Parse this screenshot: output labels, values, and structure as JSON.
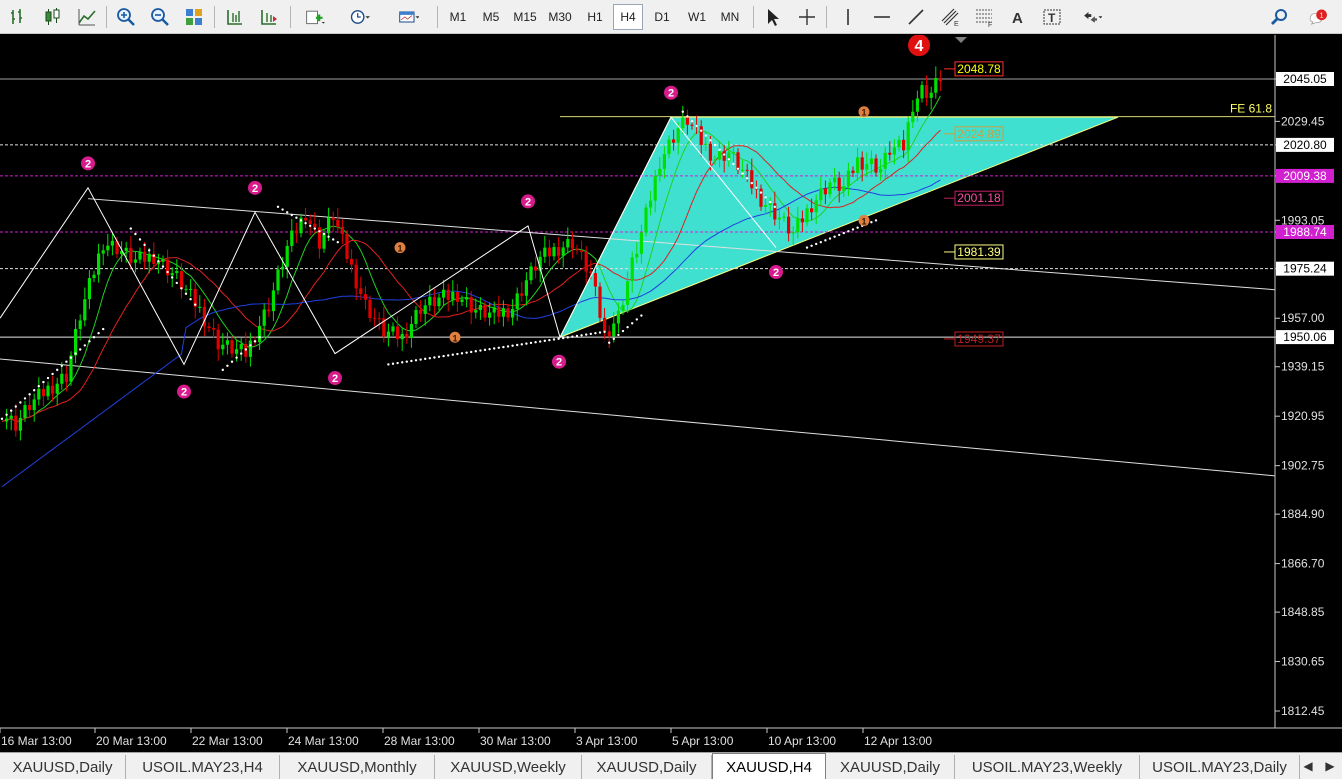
{
  "toolbar": {
    "timeframes": [
      {
        "label": "M1",
        "active": false
      },
      {
        "label": "M5",
        "active": false
      },
      {
        "label": "M15",
        "active": false
      },
      {
        "label": "M30",
        "active": false
      },
      {
        "label": "H1",
        "active": false
      },
      {
        "label": "H4",
        "active": true
      },
      {
        "label": "D1",
        "active": false
      },
      {
        "label": "W1",
        "active": false
      },
      {
        "label": "MN",
        "active": false
      }
    ],
    "icons": [
      "bar-chart-icon",
      "candlestick-icon",
      "line-chart-icon",
      "zoom-in-icon",
      "zoom-out-icon",
      "tile-windows-icon",
      "chart-shift-icon",
      "autoscroll-icon",
      "new-order-icon",
      "periods-icon",
      "templates-icon",
      "cursor-icon",
      "crosshair-icon",
      "vertical-line-icon",
      "horizontal-line-icon",
      "trendline-icon",
      "equidistant-channel-icon",
      "fibonacci-icon",
      "text-icon",
      "text-label-icon",
      "arrows-icon",
      "search-icon",
      "notifications-icon"
    ],
    "notification_count": "1"
  },
  "chart": {
    "symbol": "XAUUSD",
    "timeframe": "H4",
    "colors": {
      "background": "#000000",
      "bull": "#00e000",
      "bear": "#e00000",
      "pattern_fill": "#40e0d0",
      "zigzag_marker": "#d81b8c",
      "fractal_marker": "#e08040"
    },
    "price_labels": [
      {
        "text": "2045.05",
        "style": "white"
      },
      {
        "text": "2029.45",
        "style": "axis"
      },
      {
        "text": "2020.80",
        "style": "white"
      },
      {
        "text": "2009.38",
        "style": "magenta"
      },
      {
        "text": "1993.05",
        "style": "axis"
      },
      {
        "text": "1988.74",
        "style": "magenta"
      },
      {
        "text": "1975.24",
        "style": "white"
      },
      {
        "text": "1957.00",
        "style": "axis"
      },
      {
        "text": "1950.06",
        "style": "white"
      },
      {
        "text": "1939.15",
        "style": "axis"
      },
      {
        "text": "1920.95",
        "style": "axis"
      },
      {
        "text": "1902.75",
        "style": "axis"
      },
      {
        "text": "1884.90",
        "style": "axis"
      },
      {
        "text": "1866.70",
        "style": "axis"
      },
      {
        "text": "1848.85",
        "style": "axis"
      },
      {
        "text": "1830.65",
        "style": "axis"
      },
      {
        "text": "1812.45",
        "style": "axis"
      }
    ],
    "level_tags": [
      {
        "text": "2048.78",
        "color": "#ffff00",
        "box": "#ff3030"
      },
      {
        "text": "2024.89",
        "color": "#c8a040",
        "box": "#c8a040"
      },
      {
        "text": "2001.18",
        "color": "#ff4da6",
        "box": "#c02060"
      },
      {
        "text": "1981.39",
        "color": "#ffff80",
        "box": "#ffff80"
      },
      {
        "text": "1949.37",
        "color": "#c02020",
        "box": "#c02020"
      }
    ],
    "fe_label": "FE 61.8",
    "wave_label": "4",
    "zigzag_label": "2",
    "fractal_label": "1",
    "time_labels": [
      "16 Mar 13:00",
      "20 Mar 13:00",
      "22 Mar 13:00",
      "24 Mar 13:00",
      "28 Mar 13:00",
      "30 Mar 13:00",
      "3 Apr 13:00",
      "5 Apr 13:00",
      "10 Apr 13:00",
      "12 Apr 13:00"
    ]
  },
  "tabs": [
    {
      "label": "XAUUSD,Daily",
      "active": false
    },
    {
      "label": "USOIL.MAY23,H4",
      "active": false
    },
    {
      "label": "XAUUSD,Monthly",
      "active": false
    },
    {
      "label": "XAUUSD,Weekly",
      "active": false
    },
    {
      "label": "XAUUSD,Daily",
      "active": false
    },
    {
      "label": "XAUUSD,H4",
      "active": true
    },
    {
      "label": "XAUUSD,Daily",
      "active": false
    },
    {
      "label": "USOIL.MAY23,Weekly",
      "active": false
    },
    {
      "label": "USOIL.MAY23,Daily",
      "active": false
    }
  ]
}
